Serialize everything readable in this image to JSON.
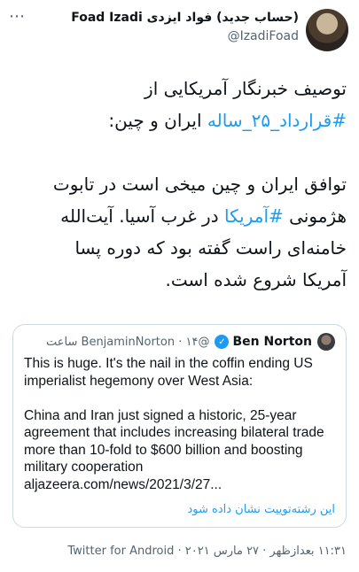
{
  "tweet": {
    "author": {
      "display_name": "(حساب جدید) فواد ایزدی Foad Izadi",
      "handle": "@IzadiFoad"
    },
    "more_icon": "⋯",
    "text_lines": {
      "l1": "توصیف خبرنگار آمریکایی از",
      "l2_hashtag": "#قرارداد_۲۵_ساله",
      "l2_rest": " ایران و چین:",
      "l3": "توافق ایران و چین میخی است در تابوت",
      "l4_pre": "هژمونی ",
      "l4_hashtag": "#آمریکا",
      "l4_post": " در غرب آسیا. آیت‌الله",
      "l5": "خامنه‌ای راست گفته بود که دوره پسا",
      "l6": "آمریکا شروع شده است."
    },
    "footer": "۱۱:۳۱ بعدازظهر · ۲۷ مارس ۲۰۲۱ · Twitter for Android"
  },
  "quote": {
    "name": "Ben Norton",
    "verified_icon": "✓",
    "meta": "@BenjaminNorton · ۱۴ ساعت",
    "lines": {
      "l1": "This is huge. It's the nail in the coffin ending US",
      "l2": "imperialist hegemony over West Asia:",
      "l3": "China and Iran just signed a historic, 25-year",
      "l4": "agreement that includes increasing bilateral trade",
      "l5": "more than 10-fold to $600 billion and boosting",
      "l6": "military cooperation",
      "l7": "aljazeera.com/news/2021/3/27..."
    },
    "show_thread": "این رشته‌توییت نشان داده شود"
  },
  "colors": {
    "accent": "#1d9bf0",
    "muted": "#536471",
    "border": "#cfd9de"
  }
}
